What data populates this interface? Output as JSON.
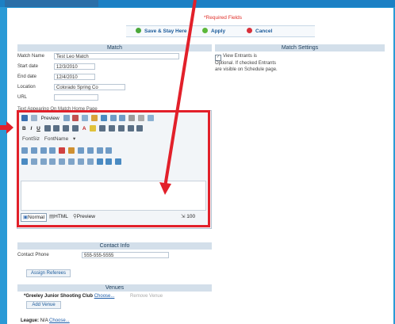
{
  "header": {
    "required_fields": "*Required Fields",
    "buttons": {
      "save_stay": "Save & Stay Here",
      "apply": "Apply",
      "cancel": "Cancel"
    }
  },
  "match": {
    "section_title": "Match",
    "fields": {
      "name_label": "Match Name",
      "name_value": "Test Leo Match",
      "start_label": "Start date",
      "start_value": "12/3/2010",
      "end_label": "End date",
      "end_value": "12/4/2010",
      "location_label": "Location",
      "location_value": "Colorado Spring Co",
      "url_label": "URL",
      "url_value": ""
    },
    "home_text_label": "Text Appearing On Match Home Page"
  },
  "settings": {
    "section_title": "Match Settings",
    "view_entrants_label": "View Entrants is",
    "note": "Optional. If checked Entrants are visible on Schedule page."
  },
  "editor": {
    "toolbar": {
      "preview_label": "Preview",
      "font_size": "FontSiz",
      "font_name": "FontName"
    },
    "modes": {
      "normal": "Normal",
      "html": "HTML",
      "preview": "Preview"
    },
    "size_label": "100"
  },
  "contact": {
    "section_title": "Contact Info",
    "phone_label": "Contact Phone",
    "phone_value": "555-555-5555",
    "assign_button": "Assign Referees"
  },
  "venues": {
    "section_title": "Venues",
    "item_name": "*Greeley Junior Shooting Club",
    "choose_link": "Choose...",
    "remove_label": "Remove Venue",
    "add_button": "Add Venue"
  },
  "league": {
    "label": "League:",
    "value": "N/A",
    "choose_link": "Choose..."
  },
  "colors": {
    "annotation": "#e2202a",
    "background": "#2a9ad6",
    "section_header": "#d3dfea"
  }
}
